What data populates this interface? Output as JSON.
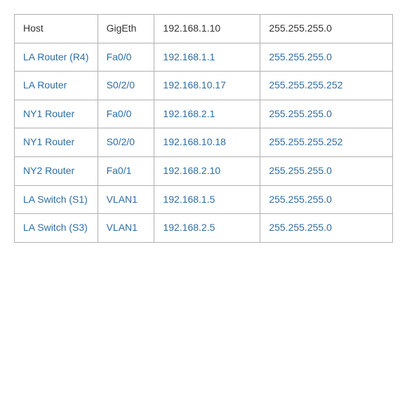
{
  "table": {
    "headers": [
      "Host",
      "GigEth",
      "192.168.1.10",
      "255.255.255.0"
    ],
    "rows": [
      {
        "device": "LA Router (R4)",
        "interface": "Fa0/0",
        "ip": "192.168.1.1",
        "subnet": "255.255.255.0"
      },
      {
        "device": "LA Router",
        "interface": "S0/2/0",
        "ip": "192.168.10.17",
        "subnet": "255.255.255.252"
      },
      {
        "device": "NY1 Router",
        "interface": "Fa0/0",
        "ip": "192.168.2.1",
        "subnet": "255.255.255.0"
      },
      {
        "device": "NY1 Router",
        "interface": "S0/2/0",
        "ip": "192.168.10.18",
        "subnet": "255.255.255.252"
      },
      {
        "device": "NY2 Router",
        "interface": "Fa0/1",
        "ip": "192.168.2.10",
        "subnet": "255.255.255.0"
      },
      {
        "device": "LA Switch (S1)",
        "interface": "VLAN1",
        "ip": "192.168.1.5",
        "subnet": "255.255.255.0"
      },
      {
        "device": "LA Switch (S3)",
        "interface": "VLAN1",
        "ip": "192.168.2.5",
        "subnet": "255.255.255.0"
      }
    ]
  }
}
